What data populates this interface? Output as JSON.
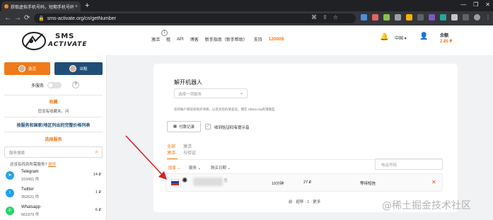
{
  "browser": {
    "tab_title": "获取虚拟手机号码，短期手机号码...",
    "tab_close": "×",
    "new_tab": "+",
    "url": "sms-activate.org/cn/getNumber",
    "back": "←",
    "forward": "→",
    "reload": "⟳",
    "window_controls": [
      "—",
      "❐",
      "✕"
    ]
  },
  "header": {
    "logo_line1": "SMS",
    "logo_line2": "ACTIVATE",
    "notification_count": "1",
    "nav": [
      "激活",
      "租",
      "API",
      "博客",
      "新手指南（新手帮助）",
      "支持"
    ],
    "points": "12000$",
    "language": "中国",
    "balance_label": "余额",
    "balance_value": "2.85 ₽"
  },
  "sidebar": {
    "tabs": [
      {
        "label": "激活",
        "color": "#f07a1a"
      },
      {
        "label": "出租",
        "color": "#1f4e79"
      }
    ],
    "multiservice_label": "多服务",
    "help": "?",
    "favorites_title": "收藏",
    "favorites_empty": "您没有收藏夹。问",
    "price_list_link": "按服务和国家/地区列出的完整价格列表",
    "select_service_title": "选择服务",
    "search_placeholder": "服务搜索",
    "not_found_text": "还没有找到所需服务?",
    "suggest_link": "提供",
    "services": [
      {
        "name": "Telegram",
        "count": "153451 件",
        "price": "14 ₽",
        "icon": "telegram-icon",
        "color": "#2aa3e0"
      },
      {
        "name": "Twitter",
        "count": "352621 件",
        "price": "1 ₽",
        "icon": "twitter-icon",
        "color": "#1da1f2"
      },
      {
        "name": "Whatsapp",
        "count": "561979 件",
        "price": "6 ₽",
        "icon": "whatsapp-icon",
        "color": "#25d366"
      }
    ]
  },
  "main": {
    "title": "解开机器人",
    "service_select_placeholder": "选择一项服务",
    "hint": "您的账户目前有购买项目，以及对您的某些任，我在 Hbbot.org有增融些",
    "history_button": "付款记录",
    "checkbox_label": "收到验证码有提示音",
    "checkbox_mark": "✓",
    "filter_tabs": [
      {
        "line1": "全部",
        "line2": "激活"
      },
      {
        "line1": "激活",
        "line2": "与验证"
      }
    ],
    "columns": [
      "国家",
      "服务",
      "购买日期"
    ],
    "phone_search_placeholder": "电话号码",
    "row": {
      "duration": "19分钟",
      "price": "27 ₽",
      "status": "等待短信",
      "cancel": "✕"
    },
    "pager": "前 · 超移 · 1 · 更多"
  },
  "watermark": "@稀土掘金技术社区"
}
